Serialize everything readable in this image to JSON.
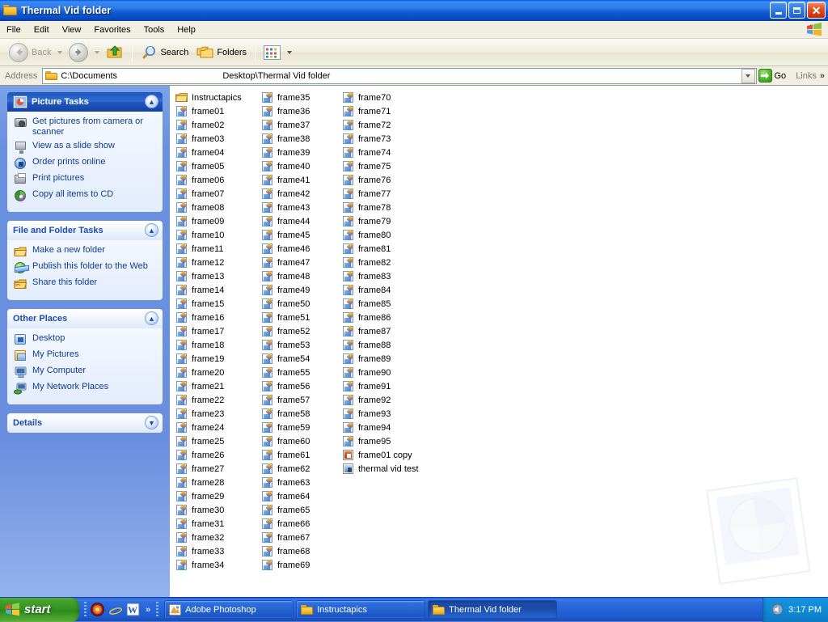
{
  "window": {
    "title": "Thermal Vid folder",
    "title_icon": "folder-icon",
    "buttons": {
      "minimize": "_",
      "maximize": "□",
      "close": "✕"
    }
  },
  "menubar": {
    "items": [
      "File",
      "Edit",
      "View",
      "Favorites",
      "Tools",
      "Help"
    ],
    "brand_icon": "windows-flag-icon"
  },
  "toolbar": {
    "back_label": "Back",
    "back_icon": "back-arrow-icon",
    "forward_icon": "forward-arrow-icon",
    "up_icon": "up-folder-icon",
    "search_label": "Search",
    "search_icon": "magnifier-icon",
    "folders_label": "Folders",
    "folders_icon": "folders-icon",
    "views_icon": "views-icon"
  },
  "address": {
    "label": "Address",
    "icon": "folder-icon",
    "value_part1": "C:\\Documents",
    "value_part2": "Desktop\\Thermal Vid folder",
    "dropdown_icon": "chevron-down-icon",
    "go_label": "Go",
    "go_icon": "go-arrow-icon",
    "links_label": "Links",
    "links_chevron": "»"
  },
  "sidebar": {
    "panels": [
      {
        "title": "Picture Tasks",
        "style": "blue",
        "header_icon": "picture-tasks-icon",
        "toggle_icon": "chevron-up-icon",
        "toggle_glyph": "▲",
        "links": [
          {
            "label": "Get pictures from camera or scanner",
            "icon": "camera-icon"
          },
          {
            "label": "View as a slide show",
            "icon": "slideshow-icon"
          },
          {
            "label": "Order prints online",
            "icon": "order-prints-icon"
          },
          {
            "label": "Print pictures",
            "icon": "printer-icon"
          },
          {
            "label": "Copy all items to CD",
            "icon": "cd-icon"
          }
        ]
      },
      {
        "title": "File and Folder Tasks",
        "style": "white",
        "toggle_icon": "chevron-up-icon",
        "toggle_glyph": "▲",
        "links": [
          {
            "label": "Make a new folder",
            "icon": "new-folder-icon"
          },
          {
            "label": "Publish this folder to the Web",
            "icon": "publish-web-icon"
          },
          {
            "label": "Share this folder",
            "icon": "share-folder-icon"
          }
        ]
      },
      {
        "title": "Other Places",
        "style": "white",
        "toggle_icon": "chevron-up-icon",
        "toggle_glyph": "▲",
        "links": [
          {
            "label": "Desktop",
            "icon": "desktop-icon"
          },
          {
            "label": "My Pictures",
            "icon": "my-pictures-icon"
          },
          {
            "label": "My Computer",
            "icon": "my-computer-icon"
          },
          {
            "label": "My Network Places",
            "icon": "my-network-places-icon"
          }
        ]
      },
      {
        "title": "Details",
        "style": "white",
        "toggle_icon": "chevron-down-icon",
        "toggle_glyph": "▼",
        "links": []
      }
    ]
  },
  "filelist": {
    "columns": [
      [
        {
          "name": "Instructapics",
          "icon": "folder-icon"
        },
        {
          "name": "frame01",
          "icon": "picture-file-icon"
        },
        {
          "name": "frame02",
          "icon": "picture-file-icon"
        },
        {
          "name": "frame03",
          "icon": "picture-file-icon"
        },
        {
          "name": "frame04",
          "icon": "picture-file-icon"
        },
        {
          "name": "frame05",
          "icon": "picture-file-icon"
        },
        {
          "name": "frame06",
          "icon": "picture-file-icon"
        },
        {
          "name": "frame07",
          "icon": "picture-file-icon"
        },
        {
          "name": "frame08",
          "icon": "picture-file-icon"
        },
        {
          "name": "frame09",
          "icon": "picture-file-icon"
        },
        {
          "name": "frame10",
          "icon": "picture-file-icon"
        },
        {
          "name": "frame11",
          "icon": "picture-file-icon"
        },
        {
          "name": "frame12",
          "icon": "picture-file-icon"
        },
        {
          "name": "frame13",
          "icon": "picture-file-icon"
        },
        {
          "name": "frame14",
          "icon": "picture-file-icon"
        },
        {
          "name": "frame15",
          "icon": "picture-file-icon"
        },
        {
          "name": "frame16",
          "icon": "picture-file-icon"
        },
        {
          "name": "frame17",
          "icon": "picture-file-icon"
        },
        {
          "name": "frame18",
          "icon": "picture-file-icon"
        },
        {
          "name": "frame19",
          "icon": "picture-file-icon"
        },
        {
          "name": "frame20",
          "icon": "picture-file-icon"
        },
        {
          "name": "frame21",
          "icon": "picture-file-icon"
        },
        {
          "name": "frame22",
          "icon": "picture-file-icon"
        },
        {
          "name": "frame23",
          "icon": "picture-file-icon"
        },
        {
          "name": "frame24",
          "icon": "picture-file-icon"
        },
        {
          "name": "frame25",
          "icon": "picture-file-icon"
        },
        {
          "name": "frame26",
          "icon": "picture-file-icon"
        },
        {
          "name": "frame27",
          "icon": "picture-file-icon"
        },
        {
          "name": "frame28",
          "icon": "picture-file-icon"
        },
        {
          "name": "frame29",
          "icon": "picture-file-icon"
        },
        {
          "name": "frame30",
          "icon": "picture-file-icon"
        },
        {
          "name": "frame31",
          "icon": "picture-file-icon"
        },
        {
          "name": "frame32",
          "icon": "picture-file-icon"
        },
        {
          "name": "frame33",
          "icon": "picture-file-icon"
        },
        {
          "name": "frame34",
          "icon": "picture-file-icon"
        }
      ],
      [
        {
          "name": "frame35",
          "icon": "picture-file-icon"
        },
        {
          "name": "frame36",
          "icon": "picture-file-icon"
        },
        {
          "name": "frame37",
          "icon": "picture-file-icon"
        },
        {
          "name": "frame38",
          "icon": "picture-file-icon"
        },
        {
          "name": "frame39",
          "icon": "picture-file-icon"
        },
        {
          "name": "frame40",
          "icon": "picture-file-icon"
        },
        {
          "name": "frame41",
          "icon": "picture-file-icon"
        },
        {
          "name": "frame42",
          "icon": "picture-file-icon"
        },
        {
          "name": "frame43",
          "icon": "picture-file-icon"
        },
        {
          "name": "frame44",
          "icon": "picture-file-icon"
        },
        {
          "name": "frame45",
          "icon": "picture-file-icon"
        },
        {
          "name": "frame46",
          "icon": "picture-file-icon"
        },
        {
          "name": "frame47",
          "icon": "picture-file-icon"
        },
        {
          "name": "frame48",
          "icon": "picture-file-icon"
        },
        {
          "name": "frame49",
          "icon": "picture-file-icon"
        },
        {
          "name": "frame50",
          "icon": "picture-file-icon"
        },
        {
          "name": "frame51",
          "icon": "picture-file-icon"
        },
        {
          "name": "frame52",
          "icon": "picture-file-icon"
        },
        {
          "name": "frame53",
          "icon": "picture-file-icon"
        },
        {
          "name": "frame54",
          "icon": "picture-file-icon"
        },
        {
          "name": "frame55",
          "icon": "picture-file-icon"
        },
        {
          "name": "frame56",
          "icon": "picture-file-icon"
        },
        {
          "name": "frame57",
          "icon": "picture-file-icon"
        },
        {
          "name": "frame58",
          "icon": "picture-file-icon"
        },
        {
          "name": "frame59",
          "icon": "picture-file-icon"
        },
        {
          "name": "frame60",
          "icon": "picture-file-icon"
        },
        {
          "name": "frame61",
          "icon": "picture-file-icon"
        },
        {
          "name": "frame62",
          "icon": "picture-file-icon"
        },
        {
          "name": "frame63",
          "icon": "picture-file-icon"
        },
        {
          "name": "frame64",
          "icon": "picture-file-icon"
        },
        {
          "name": "frame65",
          "icon": "picture-file-icon"
        },
        {
          "name": "frame66",
          "icon": "picture-file-icon"
        },
        {
          "name": "frame67",
          "icon": "picture-file-icon"
        },
        {
          "name": "frame68",
          "icon": "picture-file-icon"
        },
        {
          "name": "frame69",
          "icon": "picture-file-icon"
        }
      ],
      [
        {
          "name": "frame70",
          "icon": "picture-file-icon"
        },
        {
          "name": "frame71",
          "icon": "picture-file-icon"
        },
        {
          "name": "frame72",
          "icon": "picture-file-icon"
        },
        {
          "name": "frame73",
          "icon": "picture-file-icon"
        },
        {
          "name": "frame74",
          "icon": "picture-file-icon"
        },
        {
          "name": "frame75",
          "icon": "picture-file-icon"
        },
        {
          "name": "frame76",
          "icon": "picture-file-icon"
        },
        {
          "name": "frame77",
          "icon": "picture-file-icon"
        },
        {
          "name": "frame78",
          "icon": "picture-file-icon"
        },
        {
          "name": "frame79",
          "icon": "picture-file-icon"
        },
        {
          "name": "frame80",
          "icon": "picture-file-icon"
        },
        {
          "name": "frame81",
          "icon": "picture-file-icon"
        },
        {
          "name": "frame82",
          "icon": "picture-file-icon"
        },
        {
          "name": "frame83",
          "icon": "picture-file-icon"
        },
        {
          "name": "frame84",
          "icon": "picture-file-icon"
        },
        {
          "name": "frame85",
          "icon": "picture-file-icon"
        },
        {
          "name": "frame86",
          "icon": "picture-file-icon"
        },
        {
          "name": "frame87",
          "icon": "picture-file-icon"
        },
        {
          "name": "frame88",
          "icon": "picture-file-icon"
        },
        {
          "name": "frame89",
          "icon": "picture-file-icon"
        },
        {
          "name": "frame90",
          "icon": "picture-file-icon"
        },
        {
          "name": "frame91",
          "icon": "picture-file-icon"
        },
        {
          "name": "frame92",
          "icon": "picture-file-icon"
        },
        {
          "name": "frame93",
          "icon": "picture-file-icon"
        },
        {
          "name": "frame94",
          "icon": "picture-file-icon"
        },
        {
          "name": "frame95",
          "icon": "picture-file-icon"
        },
        {
          "name": "frame01 copy",
          "icon": "photoshop-file-icon"
        },
        {
          "name": "thermal vid test",
          "icon": "app-document-icon"
        }
      ]
    ]
  },
  "taskbar": {
    "start_label": "start",
    "start_icon": "windows-flag-icon",
    "quicklaunch": [
      {
        "icon": "media-player-icon"
      },
      {
        "icon": "internet-explorer-icon"
      },
      {
        "icon": "word-icon"
      }
    ],
    "quicklaunch_chevron": "»",
    "tasks": [
      {
        "label": "Adobe Photoshop",
        "icon": "photoshop-icon",
        "active": false
      },
      {
        "label": "Instructapics",
        "icon": "folder-icon",
        "active": false
      },
      {
        "label": "Thermal Vid folder",
        "icon": "folder-icon",
        "active": true
      }
    ],
    "tray": {
      "icons": [
        {
          "icon": "volume-icon"
        }
      ],
      "clock": "3:17 PM"
    }
  },
  "colors": {
    "title_blue": "#0a4fc4",
    "sidebar_blue": "#6b8fdf",
    "panel_header_blue": "#1d54b8",
    "link_text": "#0b3d91",
    "taskbar_blue": "#1e5bd0",
    "start_green": "#319320",
    "tray_blue": "#128bd6",
    "close_red": "#c32d07"
  }
}
